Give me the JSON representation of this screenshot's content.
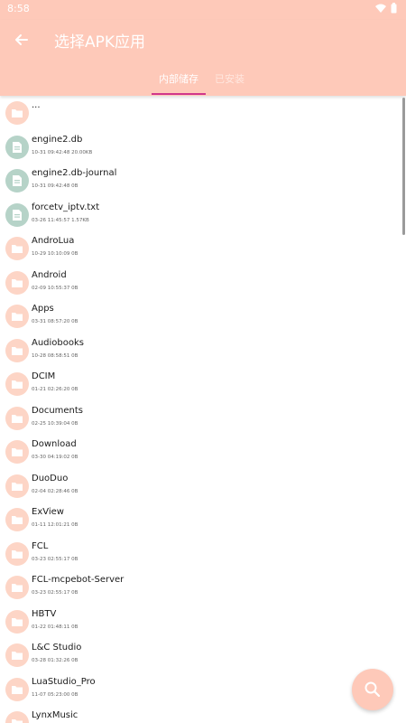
{
  "status_bar": {
    "time": "8:58"
  },
  "app_bar": {
    "title": "选择APK应用"
  },
  "tabs": [
    {
      "label": "内部储存",
      "active": true
    },
    {
      "label": "已安装",
      "active": false
    }
  ],
  "colors": {
    "accent": "#FEC9B9",
    "indicator": "#D0378B",
    "folder_icon_bg": "#FDD5C6",
    "file_icon_bg": "#B6D3C8"
  },
  "files": [
    {
      "name": "...",
      "meta": "",
      "type": "folder"
    },
    {
      "name": "engine2.db",
      "meta": "10-31 09:42:48  20.00KB",
      "type": "file"
    },
    {
      "name": "engine2.db-journal",
      "meta": "10-31 09:42:48  0B",
      "type": "file"
    },
    {
      "name": "forcetv_iptv.txt",
      "meta": "03-26 11:45:57  1.57KB",
      "type": "file"
    },
    {
      "name": "AndroLua",
      "meta": "10-29 10:10:09  0B",
      "type": "folder"
    },
    {
      "name": "Android",
      "meta": "02-09 10:55:37  0B",
      "type": "folder"
    },
    {
      "name": "Apps",
      "meta": "03-31 08:57:20  0B",
      "type": "folder"
    },
    {
      "name": "Audiobooks",
      "meta": "10-28 08:58:51  0B",
      "type": "folder"
    },
    {
      "name": "DCIM",
      "meta": "01-21 02:26:20  0B",
      "type": "folder"
    },
    {
      "name": "Documents",
      "meta": "02-25 10:39:04  0B",
      "type": "folder"
    },
    {
      "name": "Download",
      "meta": "03-30 04:19:02  0B",
      "type": "folder"
    },
    {
      "name": "DuoDuo",
      "meta": "02-04 02:28:46  0B",
      "type": "folder"
    },
    {
      "name": "ExView",
      "meta": "01-11 12:01:21  0B",
      "type": "folder"
    },
    {
      "name": "FCL",
      "meta": "03-23 02:55:17  0B",
      "type": "folder"
    },
    {
      "name": "FCL-mcpebot-Server",
      "meta": "03-23 02:55:17  0B",
      "type": "folder"
    },
    {
      "name": "HBTV",
      "meta": "01-22 01:48:11  0B",
      "type": "folder"
    },
    {
      "name": "L&C Studio",
      "meta": "03-28 01:32:26  0B",
      "type": "folder"
    },
    {
      "name": "LuaStudio_Pro",
      "meta": "11-07 05:23:00  0B",
      "type": "folder"
    },
    {
      "name": "LynxMusic",
      "meta": "",
      "type": "folder"
    }
  ]
}
